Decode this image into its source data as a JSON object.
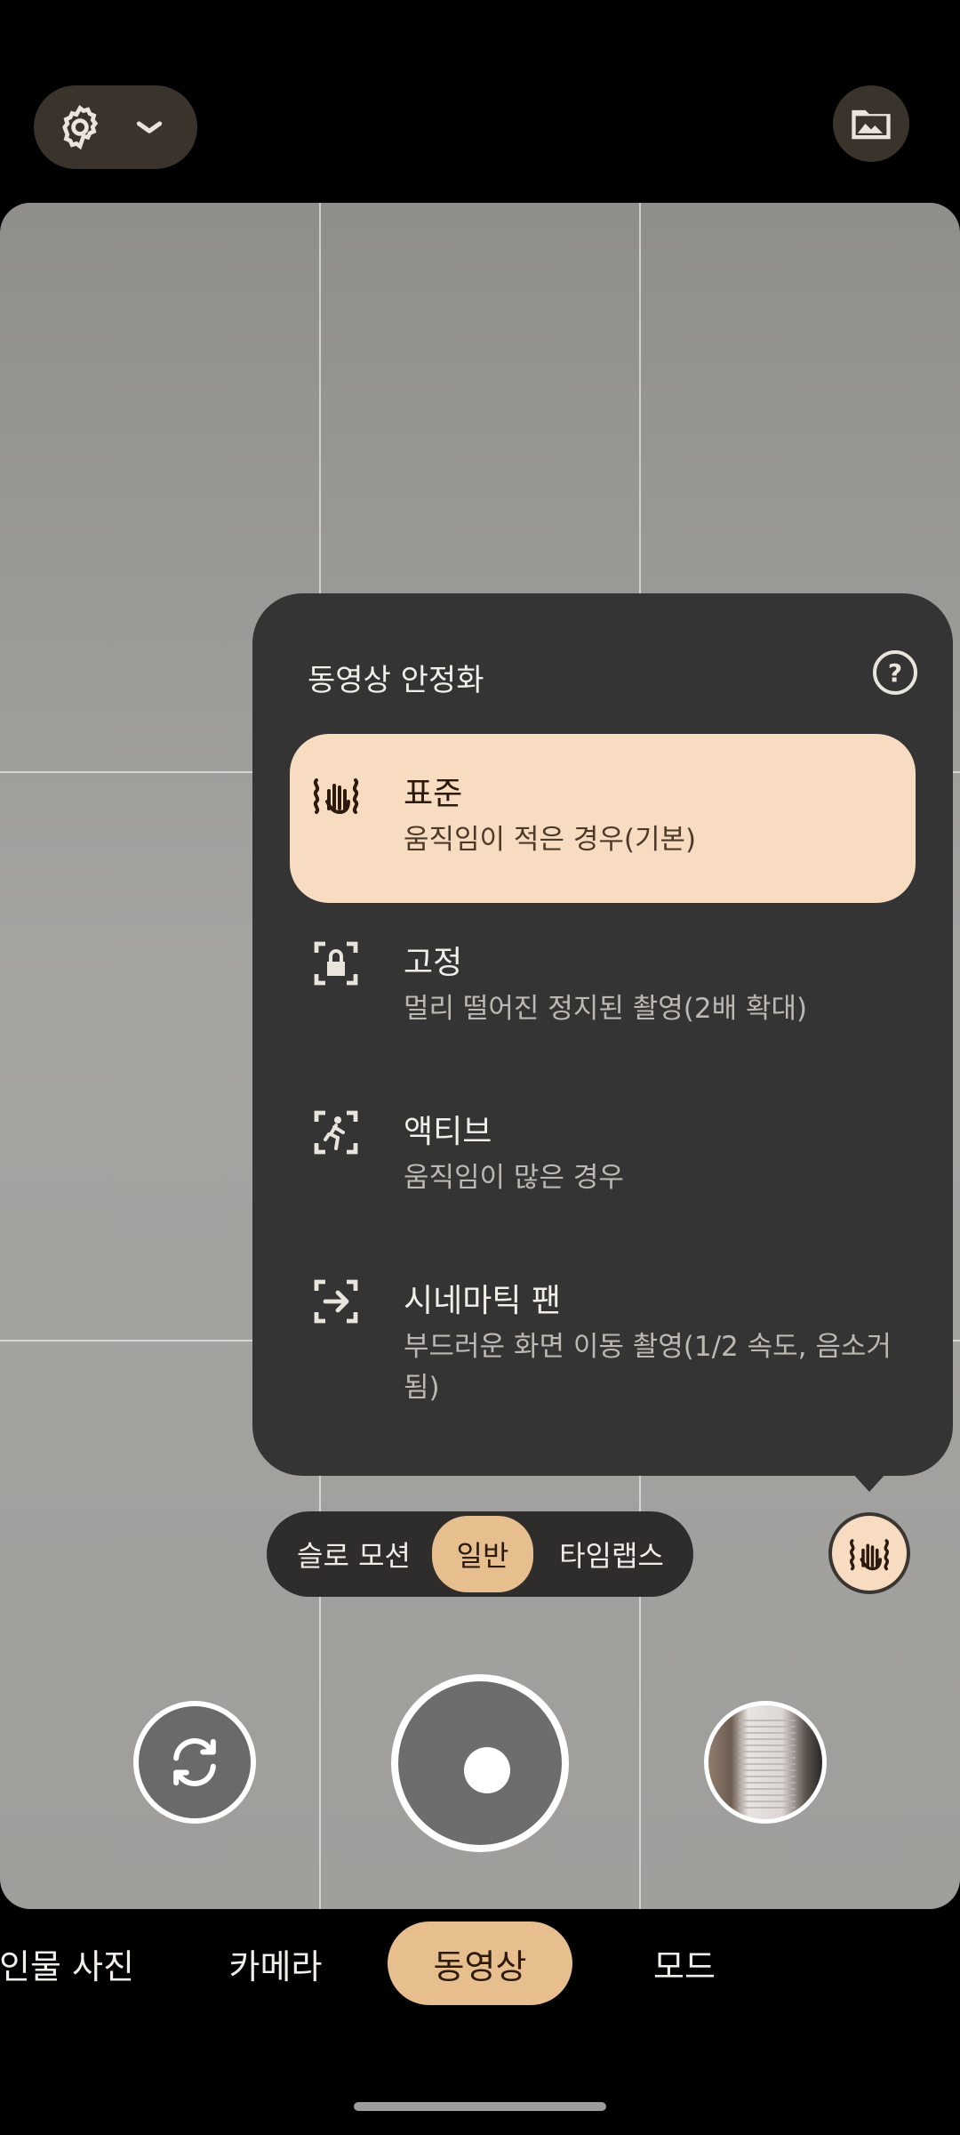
{
  "top_bar": {
    "settings_icon": "gear-icon",
    "chevron_icon": "chevron-down-icon",
    "gallery_icon": "photo-folder-icon"
  },
  "stabilization_menu": {
    "title": "동영상 안정화",
    "help_icon": "help-icon",
    "options": [
      {
        "title": "표준",
        "subtitle": "움직임이 적은 경우(기본)",
        "icon": "hand-shake-icon",
        "selected": true
      },
      {
        "title": "고정",
        "subtitle": "멀리 떨어진 정지된 촬영(2배 확대)",
        "icon": "lock-frame-icon",
        "selected": false
      },
      {
        "title": "액티브",
        "subtitle": "움직임이 많은 경우",
        "icon": "running-person-icon",
        "selected": false
      },
      {
        "title": "시네마틱 팬",
        "subtitle": "부드러운 화면 이동 촬영(1/2 속도, 음소거됨)",
        "icon": "pan-arrow-icon",
        "selected": false
      }
    ]
  },
  "video_modes": {
    "items": [
      "슬로 모션",
      "일반",
      "타임랩스"
    ],
    "selected": "일반"
  },
  "camera_modes": {
    "items": [
      "인물 사진",
      "카메라",
      "동영상",
      "모드"
    ],
    "selected": "동영상"
  },
  "controls": {
    "flip_icon": "camera-flip-icon",
    "shutter": "record-button",
    "thumbnail": "last-capture-thumbnail",
    "stabilization_icon": "hand-shake-icon"
  },
  "colors": {
    "accent": "#e7bf8e",
    "selected_option_bg": "#f7dcc1",
    "popover_bg": "#343434"
  }
}
